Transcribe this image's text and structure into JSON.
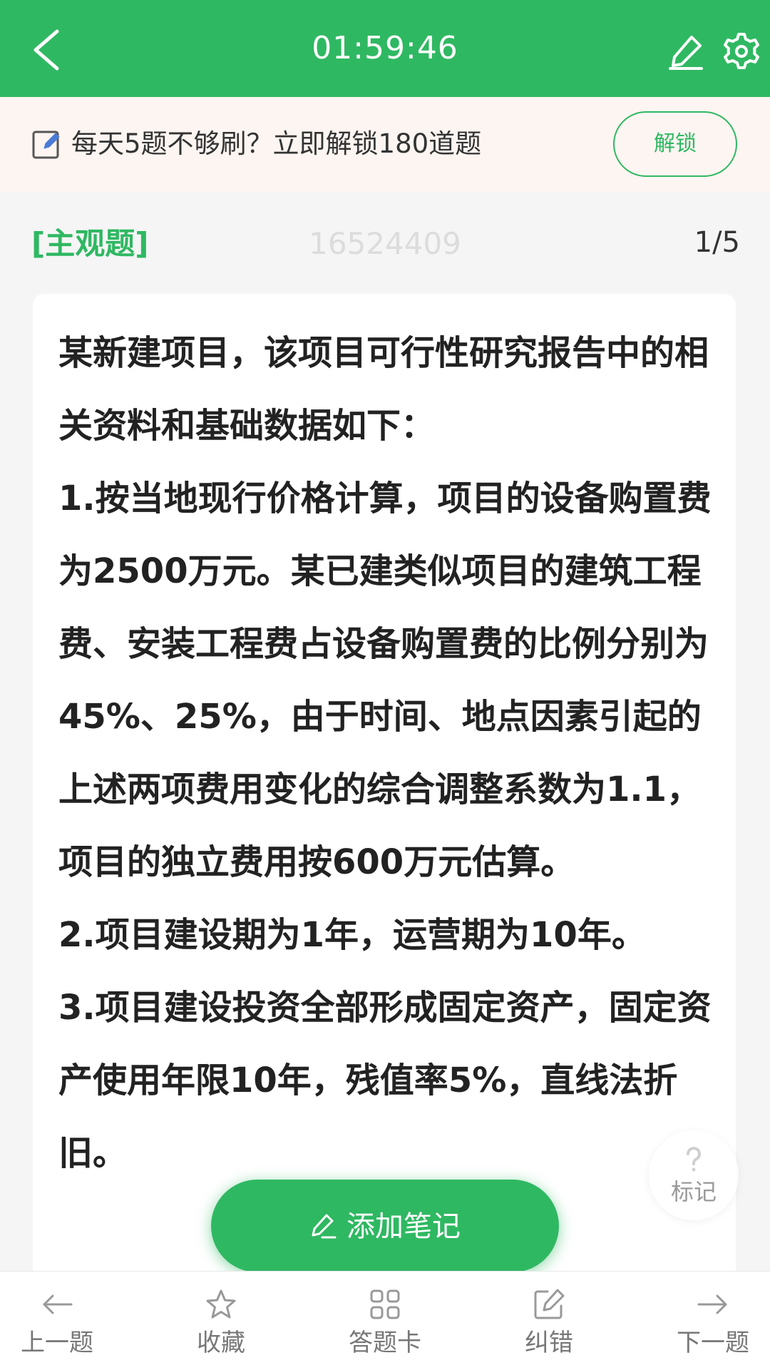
{
  "header": {
    "timer": "01:59:46",
    "back_icon": "back-arrow-icon",
    "edit_icon": "pencil-icon",
    "settings_icon": "gear-icon"
  },
  "promo": {
    "icon": "edit-note-icon",
    "text": "每天5题不够刷？立即解锁180道题",
    "button_label": "解锁"
  },
  "question": {
    "type_label": "[主观题]",
    "id": "16524409",
    "position": "1/5",
    "paragraphs": [
      "某新建项目，该项目可行性研究报告中的相关资料和基础数据如下：",
      "1.按当地现行价格计算，项目的设备购置费为2500万元。某已建类似项目的建筑工程费、安装工程费占设备购置费的比例分别为45%、25%，由于时间、地点因素引起的上述两项费用变化的综合调整系数为1.1，项目的独立费用按600万元估算。",
      "2.项目建设期为1年，运营期为10年。",
      "3.项目建设投资全部形成固定资产，固定资产使用年限10年，残值率5%，直线法折旧。"
    ]
  },
  "mark_button": {
    "icon": "question-mark-icon",
    "label": "标记"
  },
  "add_note": {
    "icon": "pencil-icon",
    "label": "添加笔记"
  },
  "bottom_nav": {
    "items": [
      {
        "label": "上一题",
        "icon": "arrow-left-icon"
      },
      {
        "label": "收藏",
        "icon": "star-icon"
      },
      {
        "label": "答题卡",
        "icon": "grid-icon"
      },
      {
        "label": "纠错",
        "icon": "edit-box-icon"
      },
      {
        "label": "下一题",
        "icon": "arrow-right-icon"
      }
    ]
  },
  "colors": {
    "brand_green": "#2fb862",
    "promo_bg": "#fdf5f1",
    "page_bg": "#f5f5f5"
  }
}
